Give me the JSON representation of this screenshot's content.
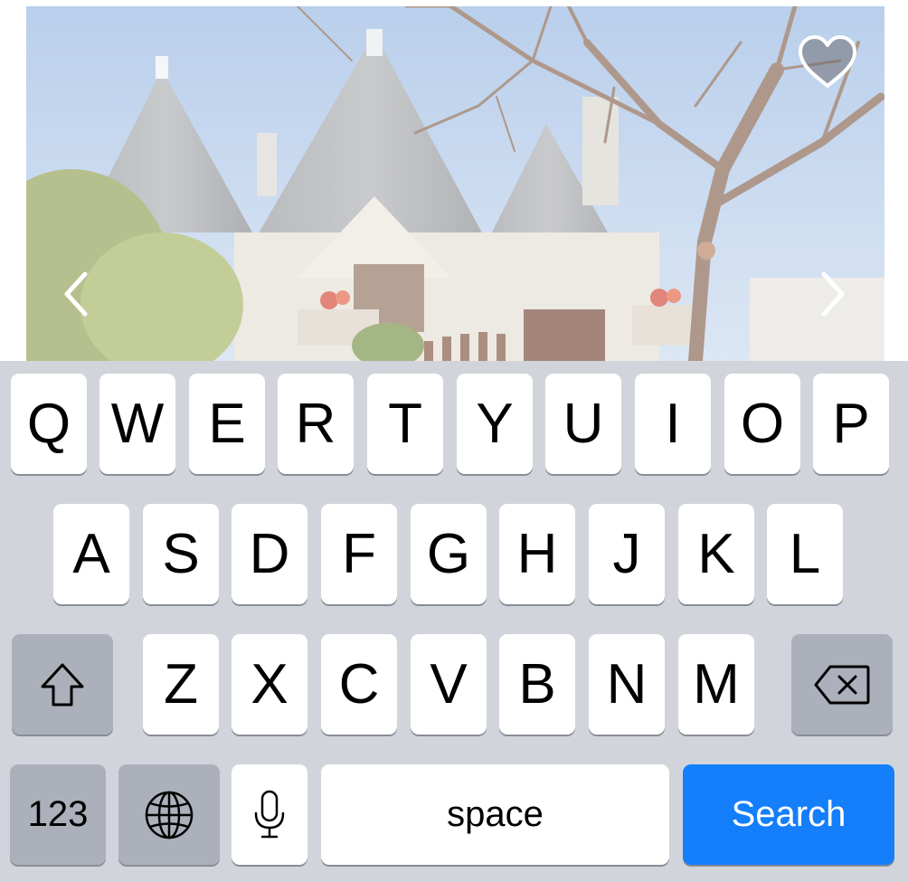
{
  "carousel": {
    "favorite_icon": "heart-outline-icon",
    "prev_icon": "chevron-left-icon",
    "next_icon": "chevron-right-icon"
  },
  "keyboard": {
    "row1": [
      "Q",
      "W",
      "E",
      "R",
      "T",
      "Y",
      "U",
      "I",
      "O",
      "P"
    ],
    "row2": [
      "A",
      "S",
      "D",
      "F",
      "G",
      "H",
      "J",
      "K",
      "L"
    ],
    "row3": [
      "Z",
      "X",
      "C",
      "V",
      "B",
      "N",
      "M"
    ],
    "shift_icon": "shift-arrow-icon",
    "backspace_icon": "delete-backward-icon",
    "numbers_label": "123",
    "globe_icon": "globe-icon",
    "mic_icon": "microphone-icon",
    "space_label": "space",
    "search_label": "Search",
    "accent_color": "#147EFB",
    "background_color": "#D1D5DB"
  }
}
